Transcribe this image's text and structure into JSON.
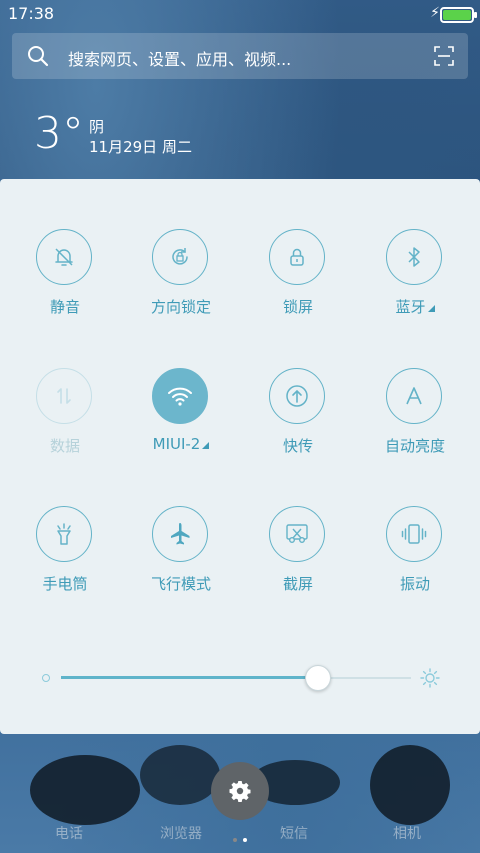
{
  "status_bar": {
    "time": "17:38",
    "charging_icon": "bolt-icon",
    "battery_color": "#5bd24a"
  },
  "search": {
    "placeholder": "搜索网页、设置、应用、视频..."
  },
  "weather": {
    "temperature": "3°",
    "condition": "阴",
    "date": "11月29日 周二"
  },
  "toggles": [
    {
      "id": "mute",
      "label": "静音",
      "icon": "bell-off-icon",
      "state": "off"
    },
    {
      "id": "rotation-lock",
      "label": "方向锁定",
      "icon": "rotation-lock-icon",
      "state": "off"
    },
    {
      "id": "lock-screen",
      "label": "锁屏",
      "icon": "lock-icon",
      "state": "off"
    },
    {
      "id": "bluetooth",
      "label": "蓝牙",
      "icon": "bluetooth-icon",
      "state": "off"
    },
    {
      "id": "mobile-data",
      "label": "数据",
      "icon": "data-arrows-icon",
      "state": "disabled"
    },
    {
      "id": "wifi",
      "label": "MIUI-2",
      "icon": "wifi-icon",
      "state": "on"
    },
    {
      "id": "quick-transfer",
      "label": "快传",
      "icon": "upload-icon",
      "state": "off"
    },
    {
      "id": "auto-brightness",
      "label": "自动亮度",
      "icon": "letter-a-icon",
      "state": "off"
    },
    {
      "id": "flashlight",
      "label": "手电筒",
      "icon": "flashlight-icon",
      "state": "off"
    },
    {
      "id": "airplane",
      "label": "飞行模式",
      "icon": "airplane-icon",
      "state": "off"
    },
    {
      "id": "screenshot",
      "label": "截屏",
      "icon": "scissors-icon",
      "state": "off"
    },
    {
      "id": "vibrate",
      "label": "振动",
      "icon": "vibrate-icon",
      "state": "off"
    }
  ],
  "brightness": {
    "level_fraction": 0.73
  },
  "dock": {
    "apps": [
      "电话",
      "浏览器",
      "短信",
      "相机"
    ],
    "page_count": 2,
    "current_page": 2
  },
  "colors": {
    "accent": "#3f9bb7",
    "active_toggle": "#6cb6cc",
    "panel_bg": "#eaf1f4"
  }
}
